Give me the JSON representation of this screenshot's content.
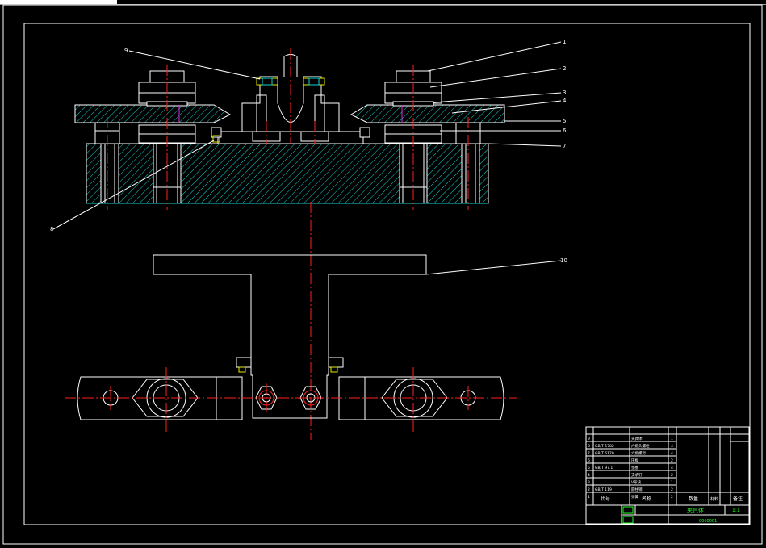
{
  "colors": {
    "background": "#000000",
    "outline": "#ffffff",
    "centerline": "#ff2020",
    "hatch": "#14d2d2",
    "green_text": "#24ff24",
    "magenta": "#e030e0",
    "yellow": "#e8e800"
  },
  "balloons": [
    "1",
    "2",
    "3",
    "4",
    "5",
    "6",
    "7",
    "8",
    "9",
    "10"
  ],
  "title_block": {
    "header_code": "代号",
    "header_name": "名称",
    "header_qty": "数量",
    "header_material": "材料",
    "header_remark": "备注",
    "drawing_title": "夹具体",
    "scale": "1:1",
    "drawing_code": "0000001"
  },
  "bom_rows": [
    {
      "code": "",
      "name": "夹具体",
      "qty": "1"
    },
    {
      "code": "GB/T 5782",
      "name": "六角头螺栓",
      "qty": "4"
    },
    {
      "code": "GB/T 6170",
      "name": "六角螺母",
      "qty": "4"
    },
    {
      "code": "",
      "name": "压板",
      "qty": "2"
    },
    {
      "code": "GB/T 97.1",
      "name": "垫圈",
      "qty": "4"
    },
    {
      "code": "",
      "name": "支承钉",
      "qty": "2"
    },
    {
      "code": "",
      "name": "V形块",
      "qty": "1"
    },
    {
      "code": "GB/T 119",
      "name": "圆柱销",
      "qty": "2"
    },
    {
      "code": "",
      "name": "弹簧",
      "qty": "2"
    }
  ]
}
